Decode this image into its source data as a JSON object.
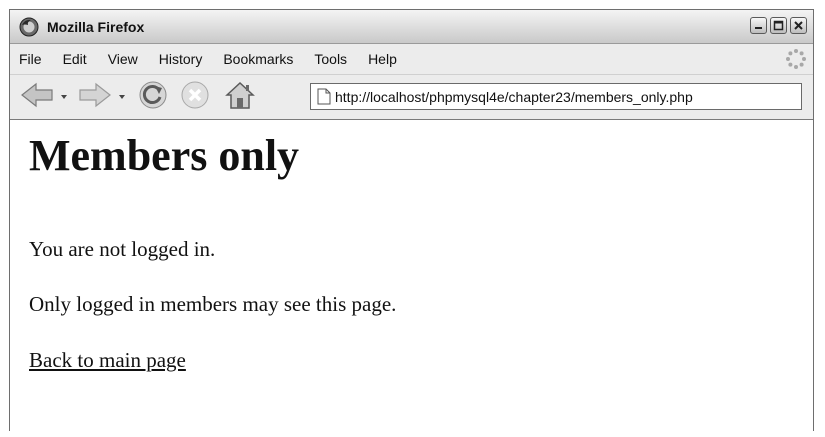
{
  "window": {
    "title": "Mozilla Firefox",
    "controls": [
      "minimize",
      "maximize",
      "close"
    ]
  },
  "menubar": {
    "items": [
      {
        "label": "File",
        "access_key": "F"
      },
      {
        "label": "Edit",
        "access_key": "E"
      },
      {
        "label": "View",
        "access_key": "V"
      },
      {
        "label": "History",
        "access_key": "s"
      },
      {
        "label": "Bookmarks",
        "access_key": "B"
      },
      {
        "label": "Tools",
        "access_key": "T"
      },
      {
        "label": "Help",
        "access_key": "H"
      }
    ]
  },
  "navbar": {
    "buttons": [
      "back-icon",
      "forward-icon",
      "reload-icon",
      "stop-icon",
      "home-icon"
    ],
    "url": "http://localhost/phpmysql4e/chapter23/members_only.php"
  },
  "page": {
    "heading": "Members only",
    "message1": "You are not logged in.",
    "message2": "Only logged in members may see this page.",
    "link_text": "Back to main page"
  },
  "colors": {
    "titlebar": "#d9d9d9",
    "chrome": "#ececec",
    "content_bg": "#ffffff",
    "text": "#111111"
  }
}
